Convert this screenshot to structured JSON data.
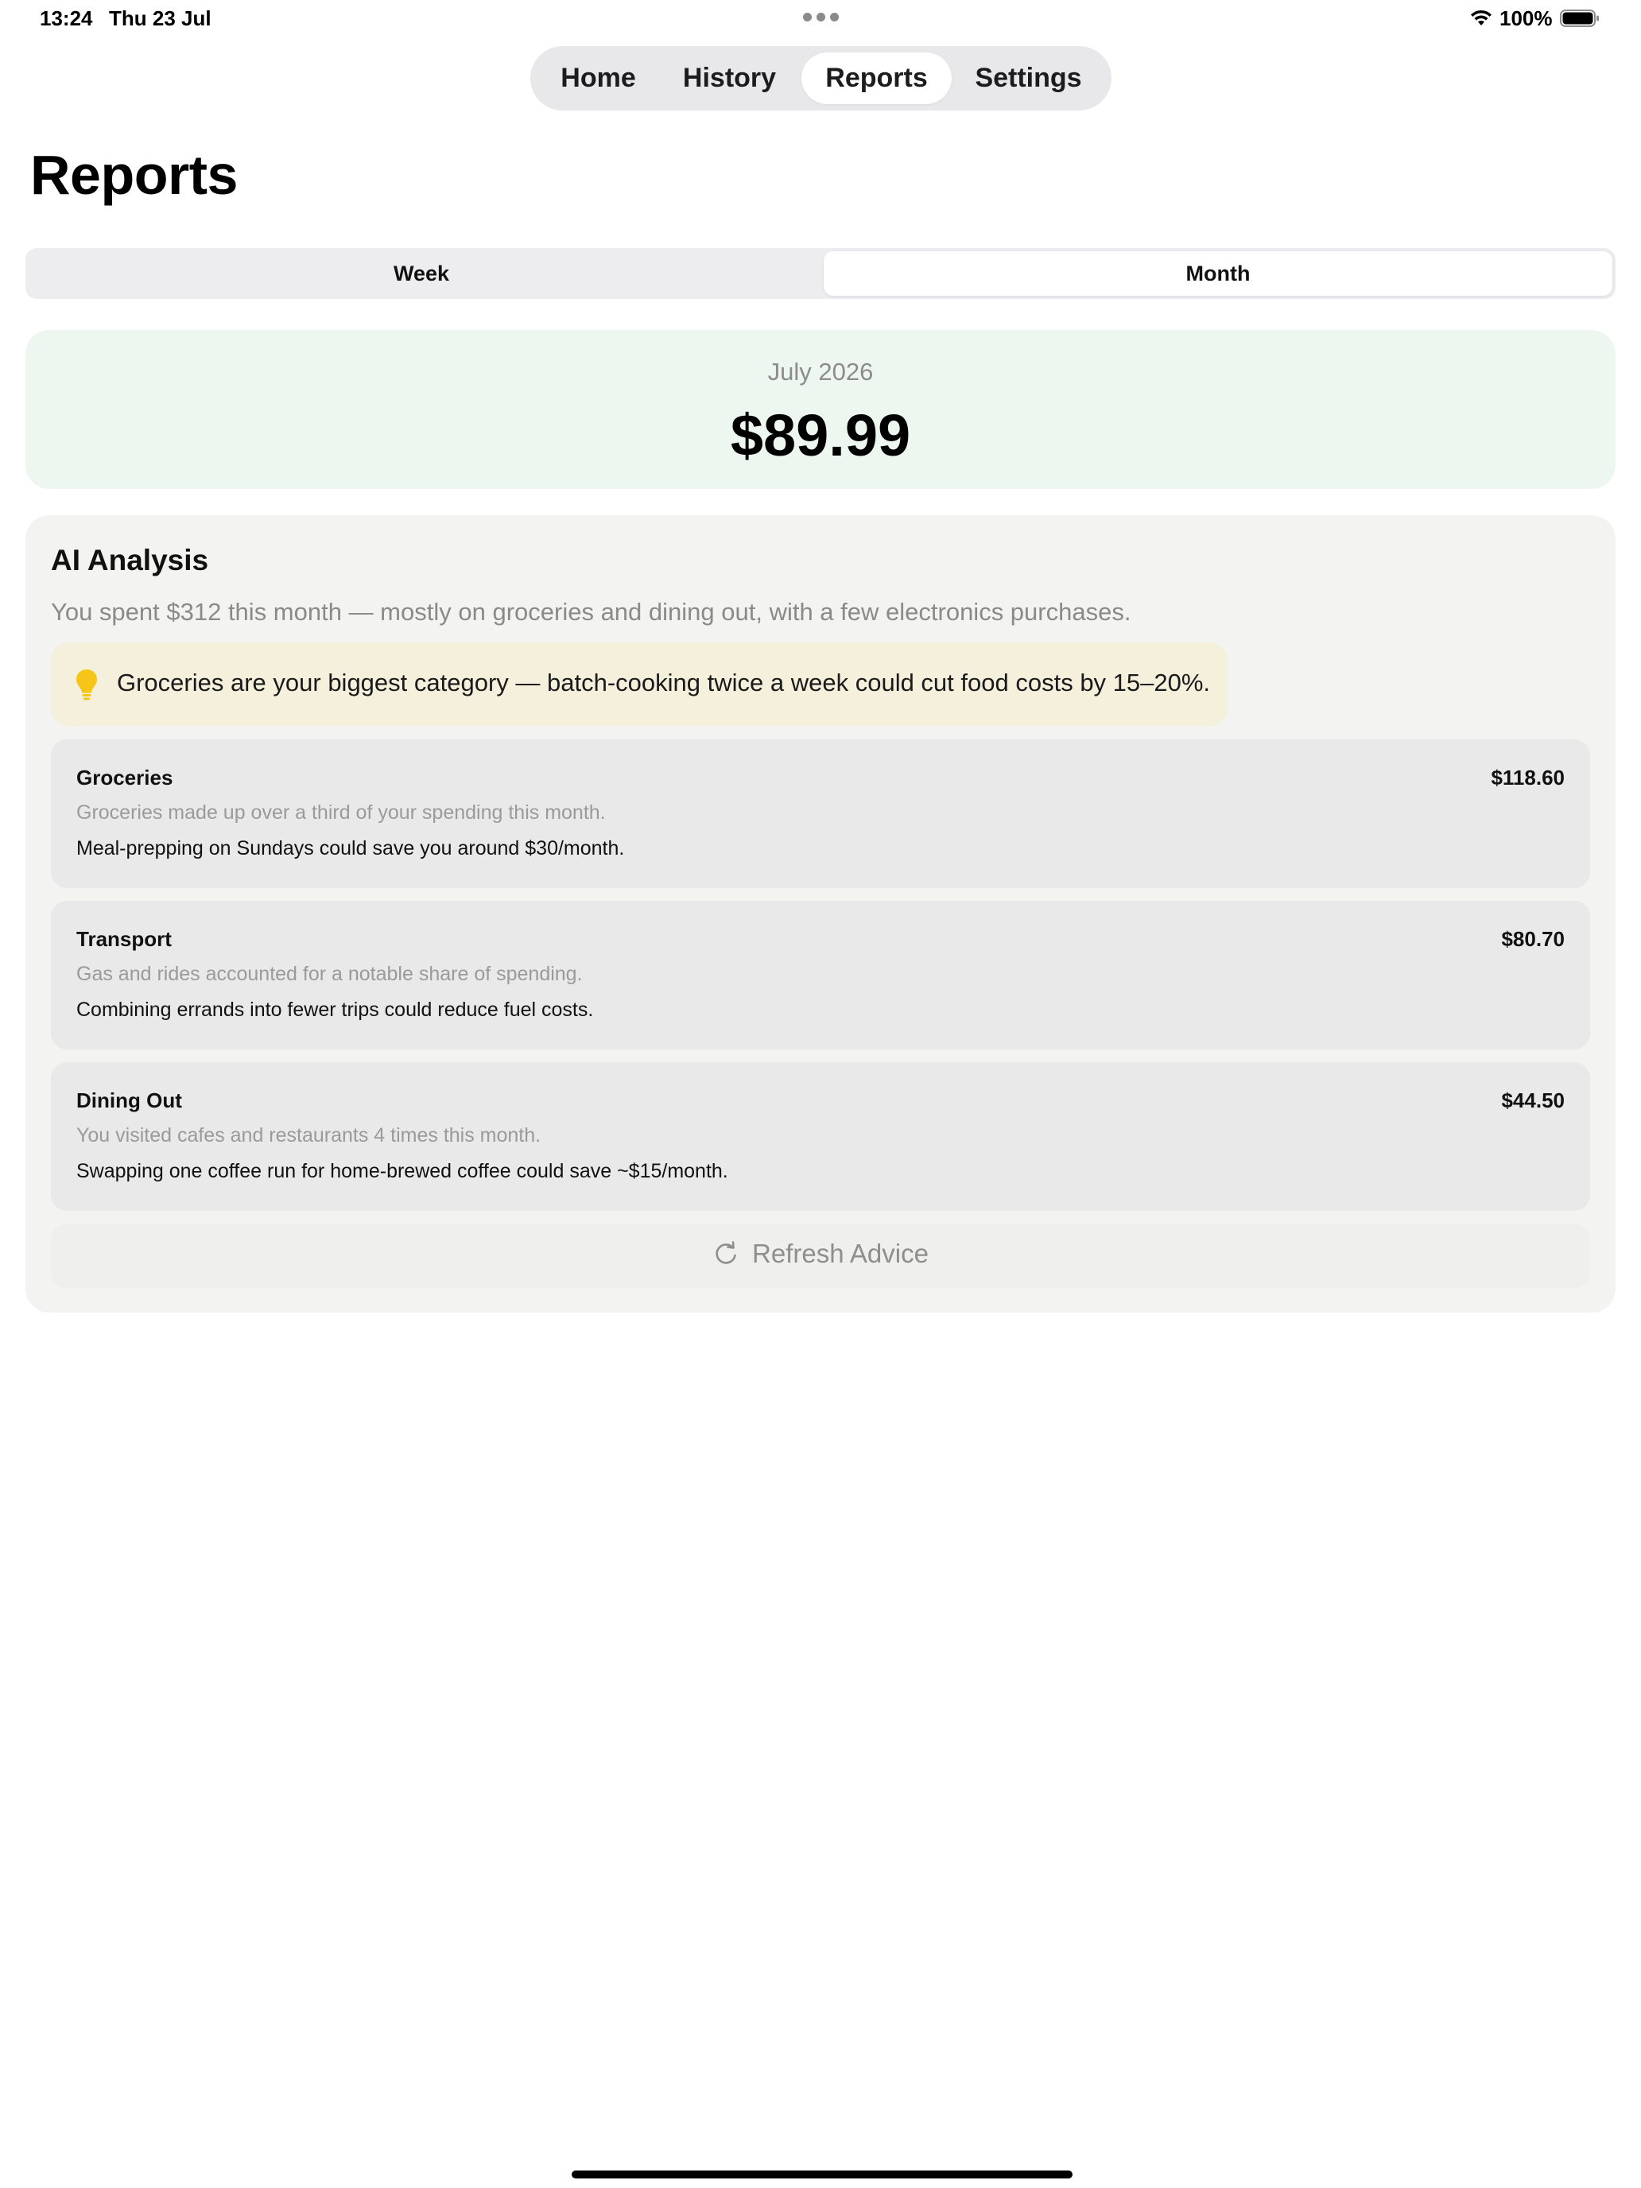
{
  "status_bar": {
    "time": "13:24",
    "date": "Thu 23 Jul",
    "battery": "100%"
  },
  "tabs": [
    {
      "label": "Home",
      "active": false
    },
    {
      "label": "History",
      "active": false
    },
    {
      "label": "Reports",
      "active": true
    },
    {
      "label": "Settings",
      "active": false
    }
  ],
  "page_title": "Reports",
  "segment": {
    "options": [
      "Week",
      "Month"
    ],
    "selected": "Month"
  },
  "summary": {
    "period": "July 2026",
    "amount": "$89.99",
    "background": "#eef7ef"
  },
  "analysis": {
    "heading": "AI Analysis",
    "summary": "You spent $312 this month — mostly on groceries and dining out, with a few electronics purchases.",
    "tip": {
      "icon": "lightbulb-icon",
      "text": "Groceries are your biggest category — batch-cooking twice a week could cut food costs by 15–20%."
    },
    "categories": [
      {
        "name": "Groceries",
        "amount": "$118.60",
        "description": "Groceries made up over a third of your spending this month.",
        "advice": "Meal-prepping on Sundays could save you around $30/month."
      },
      {
        "name": "Transport",
        "amount": "$80.70",
        "description": "Gas and rides accounted for a notable share of spending.",
        "advice": "Combining errands into fewer trips could reduce fuel costs."
      },
      {
        "name": "Dining Out",
        "amount": "$44.50",
        "description": "You visited cafes and restaurants 4 times this month.",
        "advice": "Swapping one coffee run for home-brewed coffee could save ~$15/month."
      }
    ],
    "refresh_label": "Refresh Advice"
  }
}
